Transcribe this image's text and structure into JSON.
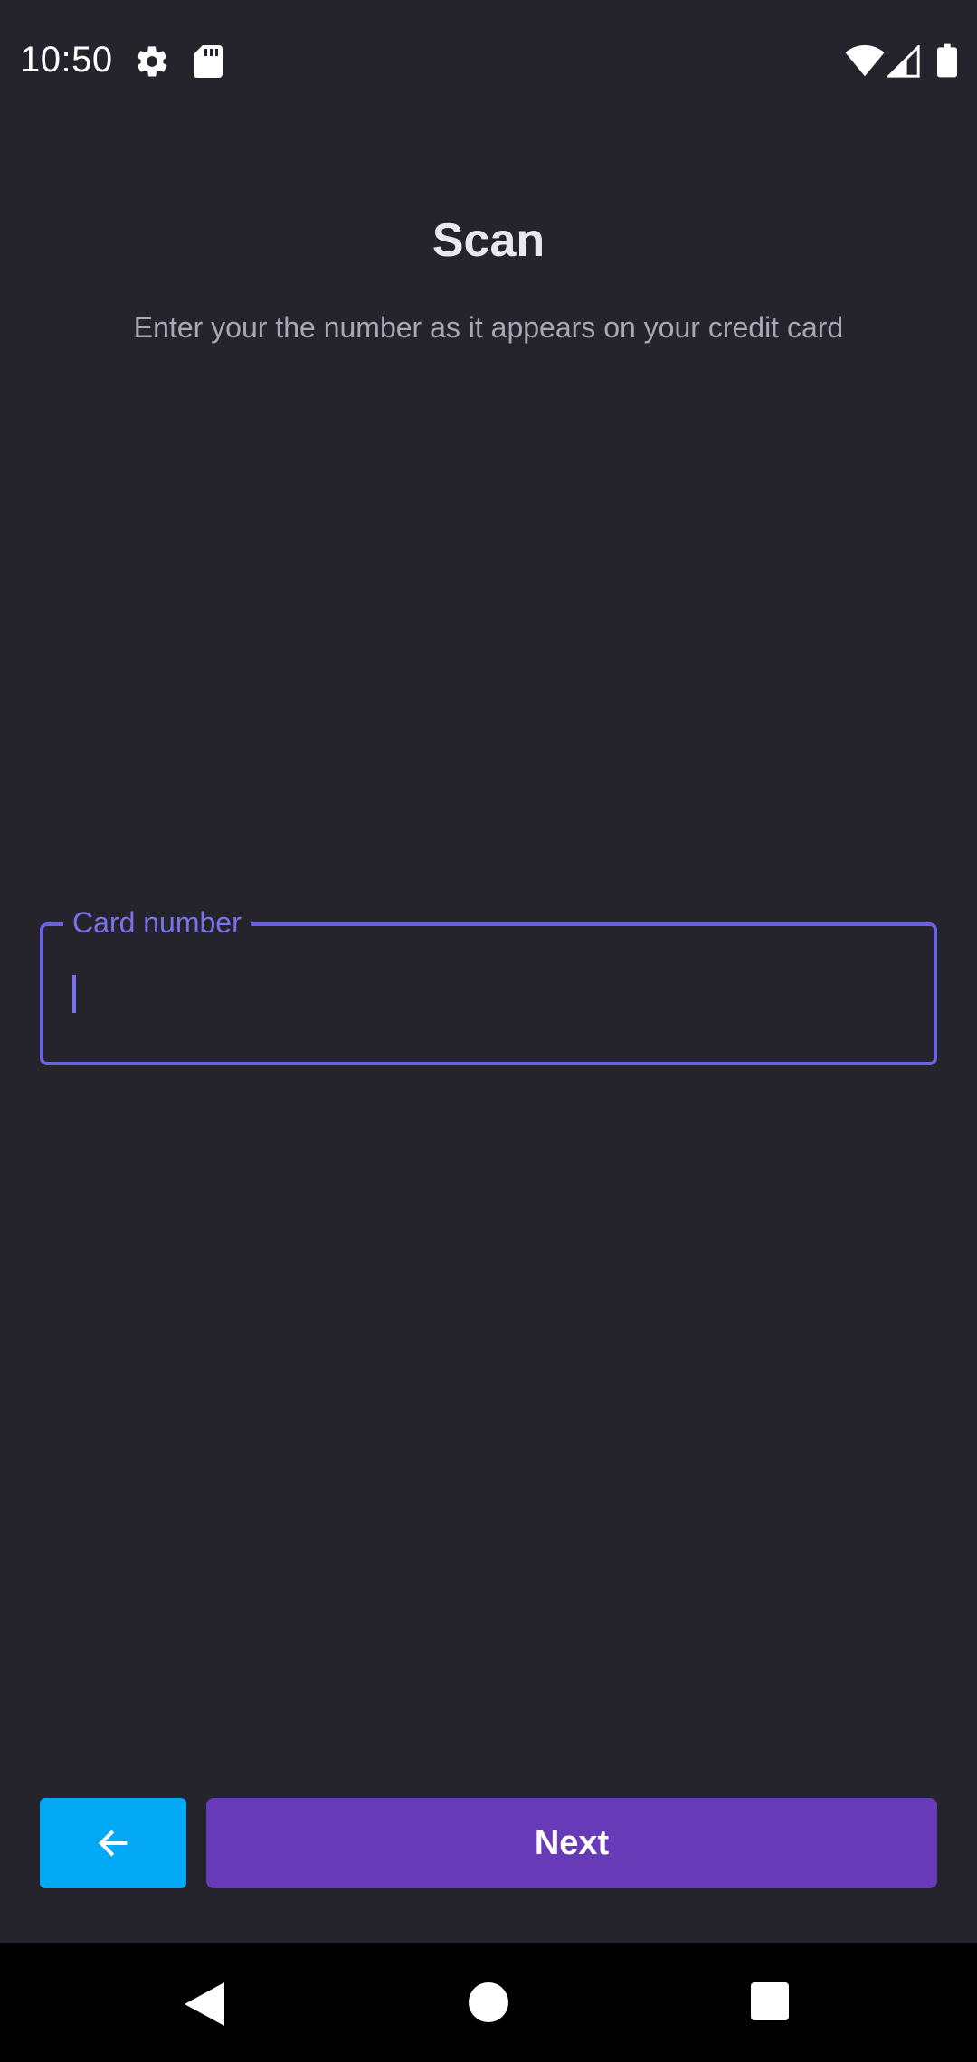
{
  "status_bar": {
    "time": "10:50",
    "icons": [
      "settings-icon",
      "sd-card-icon",
      "wifi-icon",
      "signal-icon",
      "battery-icon"
    ]
  },
  "header": {
    "title": "Scan",
    "subtitle": "Enter your the number as it appears on your credit card"
  },
  "card_field": {
    "label": "Card number",
    "value": ""
  },
  "buttons": {
    "back_icon": "arrow-left-icon",
    "next_label": "Next"
  },
  "nav_bar": {
    "icons": [
      "nav-back-icon",
      "nav-home-icon",
      "nav-recents-icon"
    ]
  },
  "colors": {
    "background": "#25242c",
    "accent": "#6a61e0",
    "back_button": "#03a9f4",
    "next_button": "#673ab7"
  }
}
